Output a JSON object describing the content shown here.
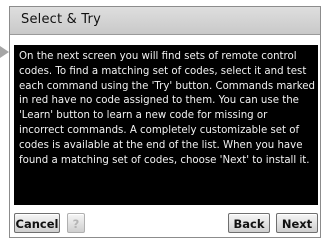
{
  "window": {
    "title": "Select & Try"
  },
  "content": {
    "text": "On the next screen you will find sets of remote control codes. To find a matching set of codes, select it and test each command using the 'Try' button. Commands marked in red have no code assigned to them. You can use the 'Learn' button to learn a new code for missing or incorrect commands. A completely customizable set of codes is available at the end of the list. When you have found a matching set of codes, choose 'Next' to install it."
  },
  "buttons": {
    "cancel": "Cancel",
    "help": "?",
    "back": "Back",
    "next": "Next"
  },
  "colors": {
    "content_background": "#000000",
    "content_text": "#f2f2f2",
    "title_bar": "#d4d4d4",
    "help_disabled": "#b5b5b5"
  }
}
